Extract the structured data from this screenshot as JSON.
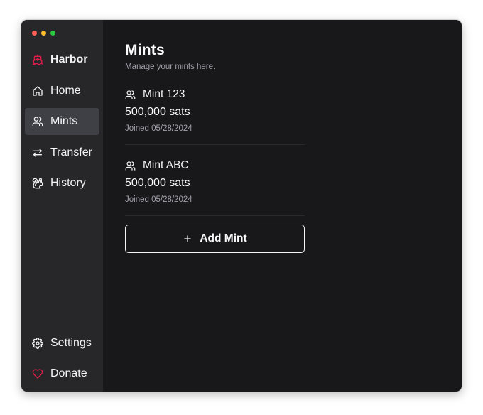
{
  "app": {
    "name": "Harbor"
  },
  "sidebar": {
    "items": [
      {
        "id": "home",
        "label": "Home",
        "icon": "home-icon"
      },
      {
        "id": "mints",
        "label": "Mints",
        "icon": "users-icon",
        "active": true
      },
      {
        "id": "transfer",
        "label": "Transfer",
        "icon": "arrows-left-right-icon"
      },
      {
        "id": "history",
        "label": "History",
        "icon": "squirrel-icon"
      }
    ],
    "bottom": [
      {
        "id": "settings",
        "label": "Settings",
        "icon": "gear-icon"
      },
      {
        "id": "donate",
        "label": "Donate",
        "icon": "heart-icon"
      }
    ]
  },
  "page": {
    "title": "Mints",
    "subtitle": "Manage your mints here."
  },
  "mints": [
    {
      "name": "Mint 123",
      "balance": "500,000 sats",
      "joined": "Joined 05/28/2024"
    },
    {
      "name": "Mint ABC",
      "balance": "500,000 sats",
      "joined": "Joined 05/28/2024"
    }
  ],
  "actions": {
    "add_mint": "Add Mint"
  },
  "colors": {
    "accent": "#e11d48",
    "background": "#18181b",
    "sidebar": "#27272a",
    "active_item": "#3f3f46"
  }
}
